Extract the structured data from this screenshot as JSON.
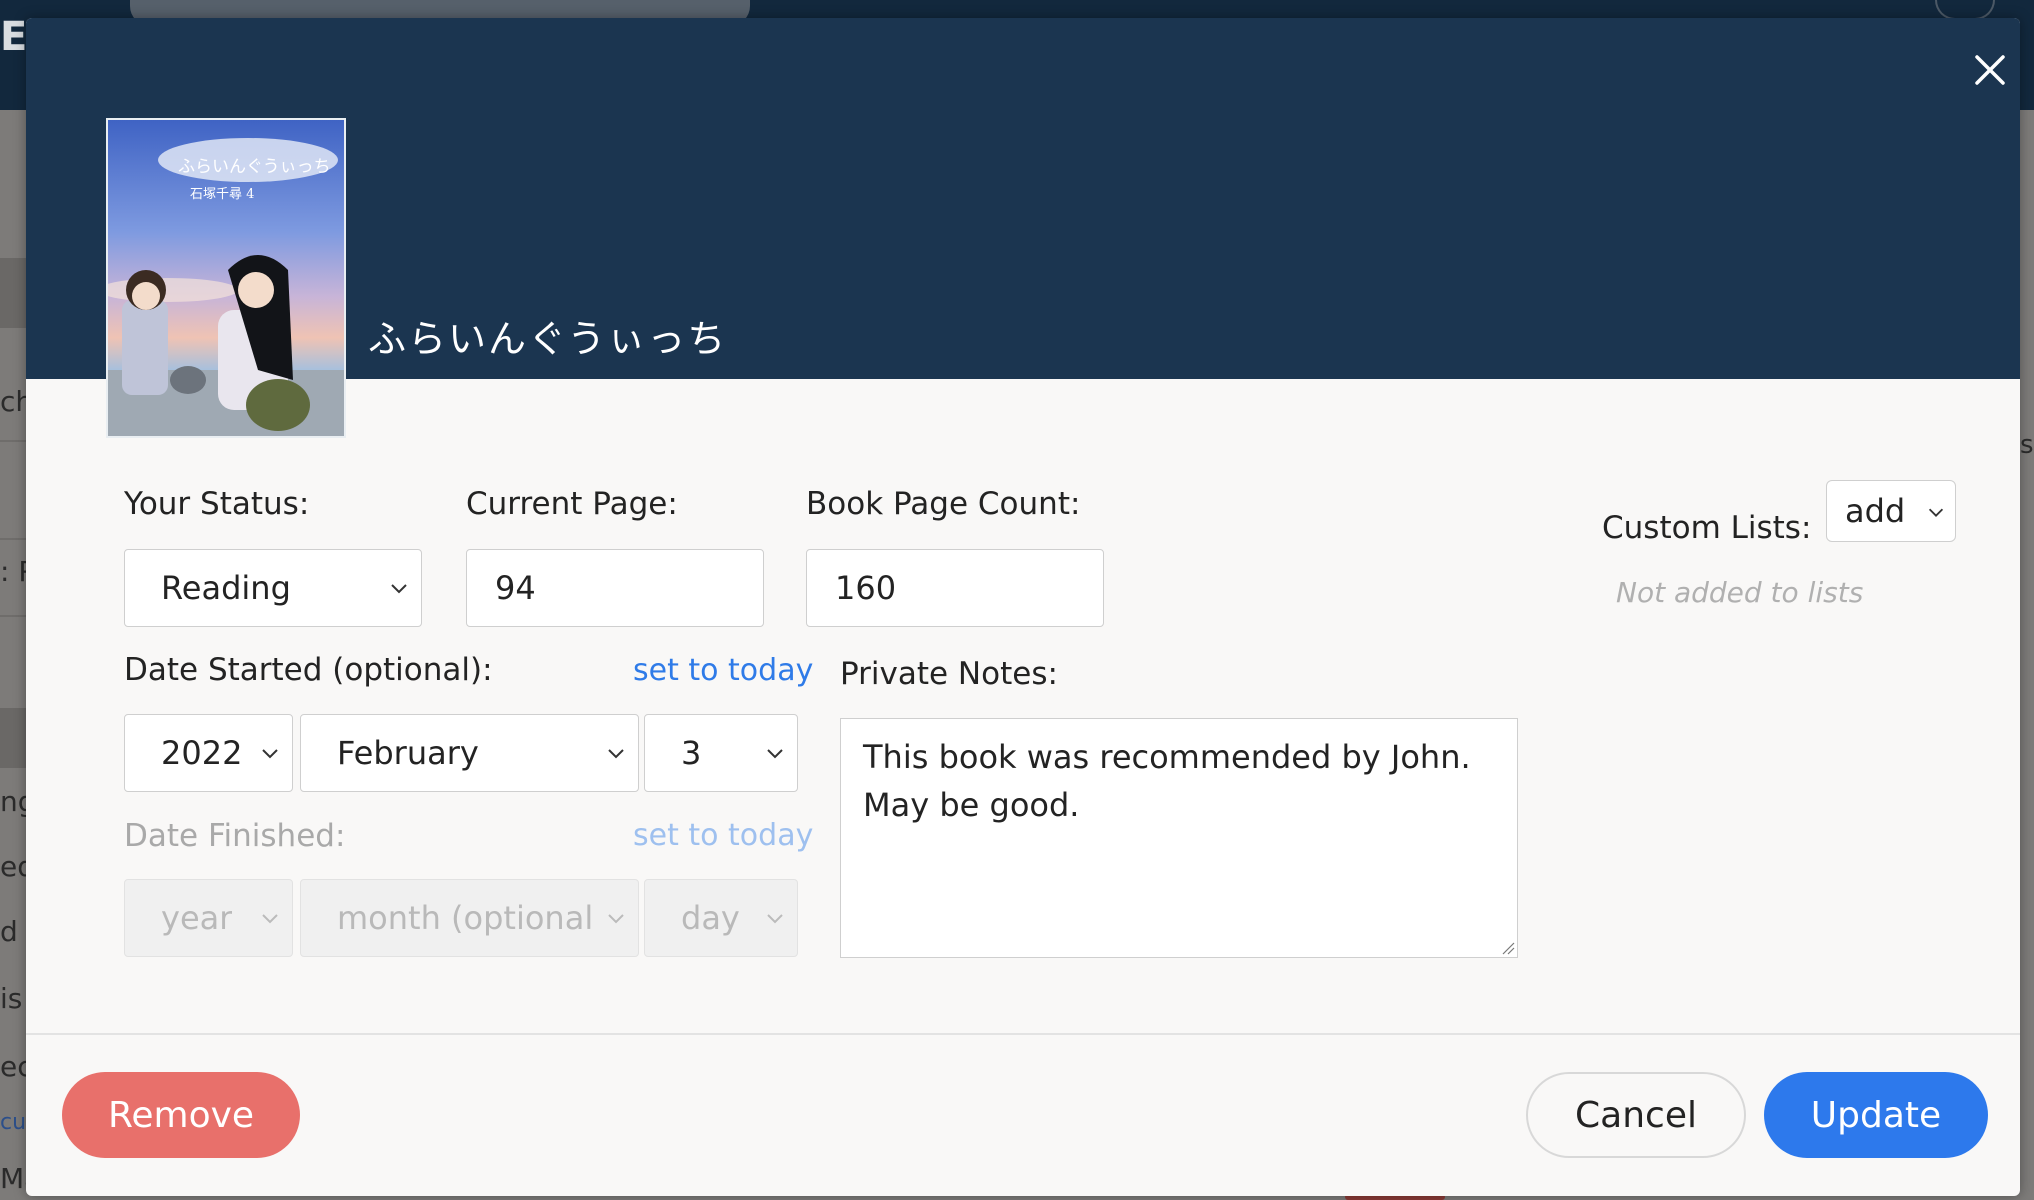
{
  "background": {
    "logo_fragment": "EW",
    "side_fragments": [
      "ch",
      ": R",
      "ng",
      "ed",
      "d",
      "is",
      "ec",
      "cu",
      "Ma"
    ],
    "right_fragment": "s"
  },
  "modal": {
    "book_title": "ふらいんぐうぃっち",
    "cover": {
      "title_text": "ふらいんぐうぃっち",
      "author_text": "石塚千尋 4"
    },
    "status": {
      "label": "Your Status:",
      "value": "Reading"
    },
    "current_page": {
      "label": "Current Page:",
      "value": "94"
    },
    "book_page_count": {
      "label": "Book Page Count:",
      "value": "160"
    },
    "date_started": {
      "label": "Date Started (optional):",
      "set_today": "set to today",
      "year": "2022",
      "month": "February",
      "day": "3"
    },
    "date_finished": {
      "label": "Date Finished:",
      "set_today": "set to today",
      "year_placeholder": "year",
      "month_placeholder": "month (optional)",
      "day_placeholder": "day"
    },
    "private_notes": {
      "label": "Private Notes:",
      "line1": "This book was recommended by John.",
      "line2": "May be good."
    },
    "custom_lists": {
      "label": "Custom Lists:",
      "select_value": "add",
      "empty_text": "Not added to lists"
    },
    "buttons": {
      "remove": "Remove",
      "cancel": "Cancel",
      "update": "Update"
    }
  },
  "colors": {
    "header_bg": "#1b3550",
    "remove_bg": "#e8706b",
    "update_bg": "#2d79ec",
    "link": "#2f7be8"
  }
}
